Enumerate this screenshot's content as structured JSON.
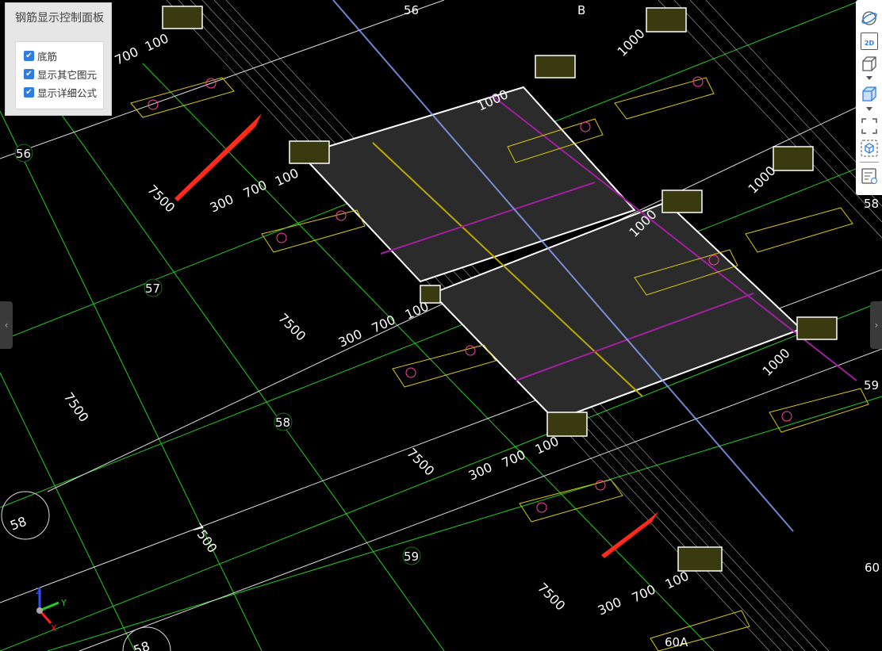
{
  "panel": {
    "title": "钢筋显示控制面板",
    "options": [
      {
        "label": "底筋",
        "checked": true
      },
      {
        "label": "显示其它图元",
        "checked": true
      },
      {
        "label": "显示详细公式",
        "checked": true
      }
    ]
  },
  "toolbar": {
    "items": [
      "orbit-icon",
      "2d-view-icon",
      "cube-outline-icon",
      "cube-solid-icon",
      "fit-extent-icon",
      "view-cube-icon",
      "properties-panel-icon"
    ],
    "view_2d_label": "2D"
  },
  "scene": {
    "axis_labels": [
      "56",
      "57",
      "58",
      "59",
      "60",
      "B",
      "56",
      "58",
      "59",
      "60A"
    ],
    "circle_labels": [
      "58",
      "58"
    ],
    "dimensions": {
      "span": "7500",
      "d300": "300",
      "d700": "700",
      "d1000": "1000",
      "d100": "100"
    },
    "triad": {
      "x": "X",
      "y": "Y",
      "z": "Z"
    }
  },
  "colors": {
    "grid": "#1fd01f",
    "rebar": "#ff66cc",
    "beam": "#ffffff",
    "accent": "#2f7de1",
    "arrow": "#ff2a1a"
  }
}
